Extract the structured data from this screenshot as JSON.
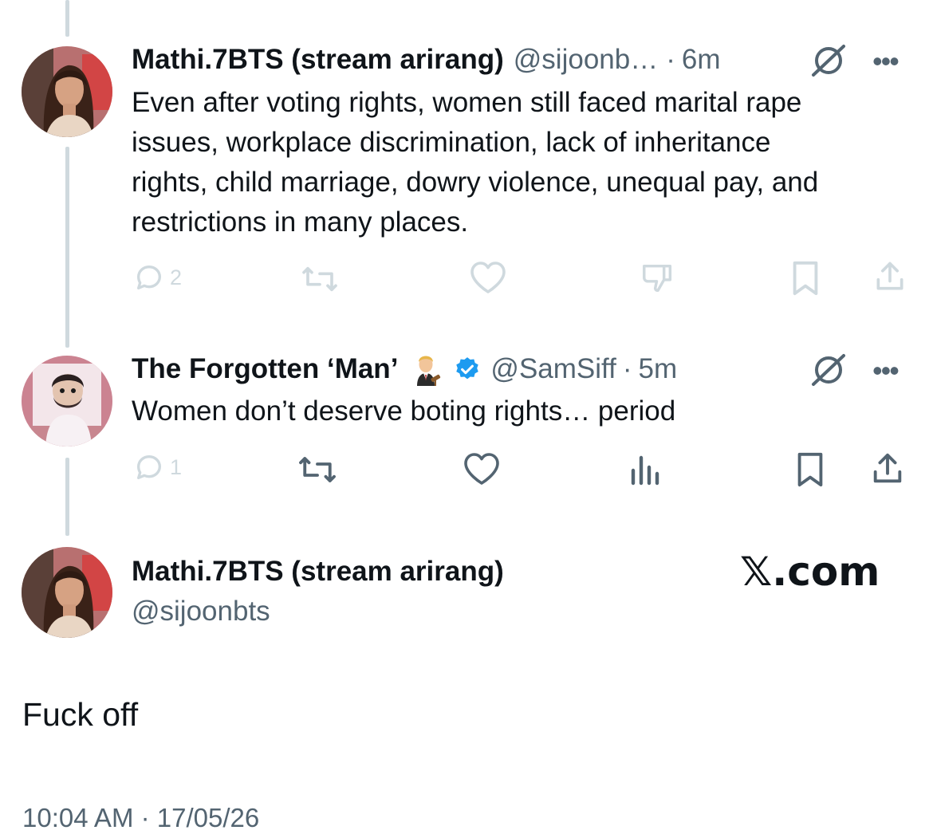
{
  "tweet1": {
    "display_name": "Mathi.7BTS (stream arirang)",
    "handle": "@sijoonb…",
    "dot": "·",
    "time": "6m",
    "text": "Even after voting rights, women still faced marital rape issues, workplace discrimination, lack of inheritance rights, child marriage, dowry violence, unequal pay, and restrictions in many places.",
    "reply_count": "2",
    "more": "•••"
  },
  "tweet2": {
    "display_name": "The Forgotten ‘Man’",
    "handle": "@SamSiff",
    "dot": "·",
    "time": "5m",
    "text": "Women don’t deserve boting rights… period",
    "reply_count": "1",
    "more": "•••"
  },
  "main_tweet": {
    "display_name": "Mathi.7BTS (stream arirang)",
    "handle": "@sijoonbts",
    "watermark": "𝕏.com",
    "text": "Fuck off",
    "timestamp": "10:04 AM · 17/05/26"
  },
  "colors": {
    "text": "#0f1419",
    "secondary": "#536471",
    "faded_icon": "#cfd9de",
    "verified": "#1d9bf0",
    "thread_line": "#cfd9de"
  },
  "icons": [
    "reply-icon",
    "retweet-icon",
    "like-icon",
    "dislike-icon",
    "views-icon",
    "bookmark-icon",
    "share-icon",
    "grok-icon",
    "more-icon",
    "verified-badge-icon",
    "judge-emoji-icon"
  ]
}
